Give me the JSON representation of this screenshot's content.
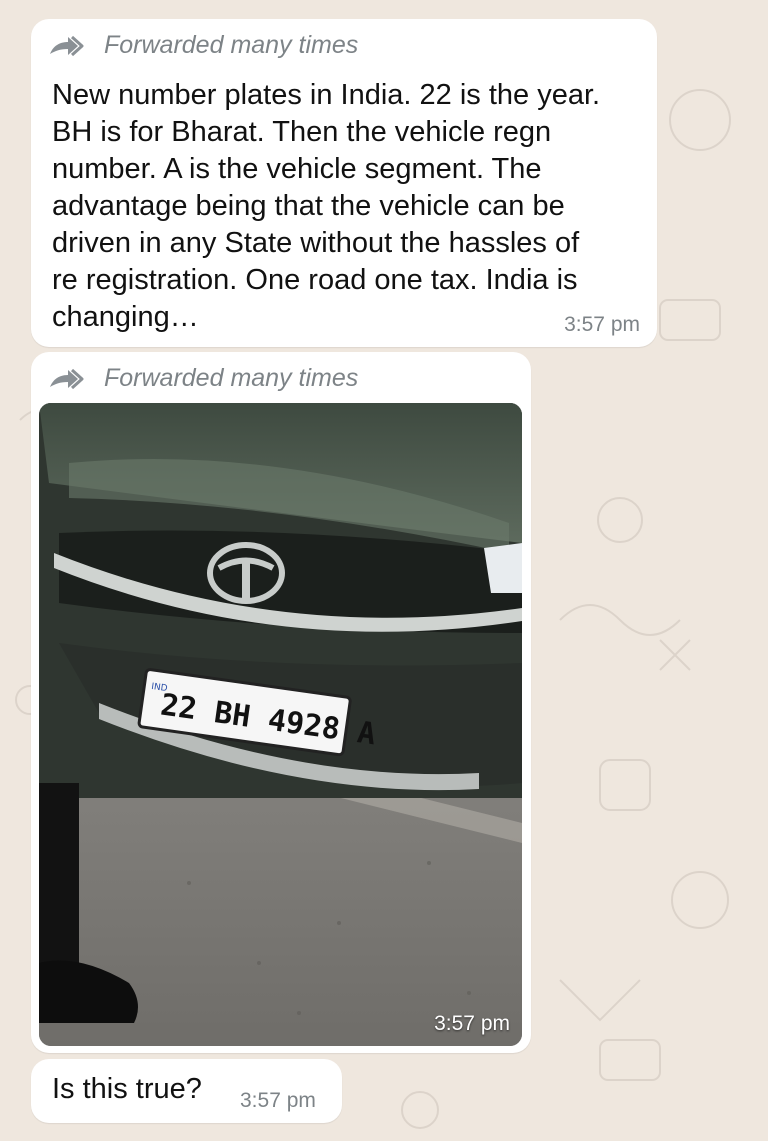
{
  "colors": {
    "background": "#efe7de",
    "bubble": "#ffffff",
    "meta": "#7d8387",
    "text": "#111111"
  },
  "messages": [
    {
      "forwarded_label": "Forwarded many times",
      "text": "New number plates in India. 22 is the year.\nBH is for Bharat. Then the vehicle regn\nnumber. A is the vehicle segment. The\nadvantage being that the vehicle can be\ndriven in any State without the hassles of\nre registration. One road one tax. India is\nchanging…",
      "time": "3:57 pm"
    },
    {
      "forwarded_label": "Forwarded many times",
      "image": {
        "plate_country": "IND",
        "plate_text": "22 BH 4928 A"
      },
      "time": "3:57 pm"
    },
    {
      "text": "Is this true?",
      "time": "3:57 pm"
    }
  ],
  "icons": {
    "forward": "forward-icon"
  }
}
